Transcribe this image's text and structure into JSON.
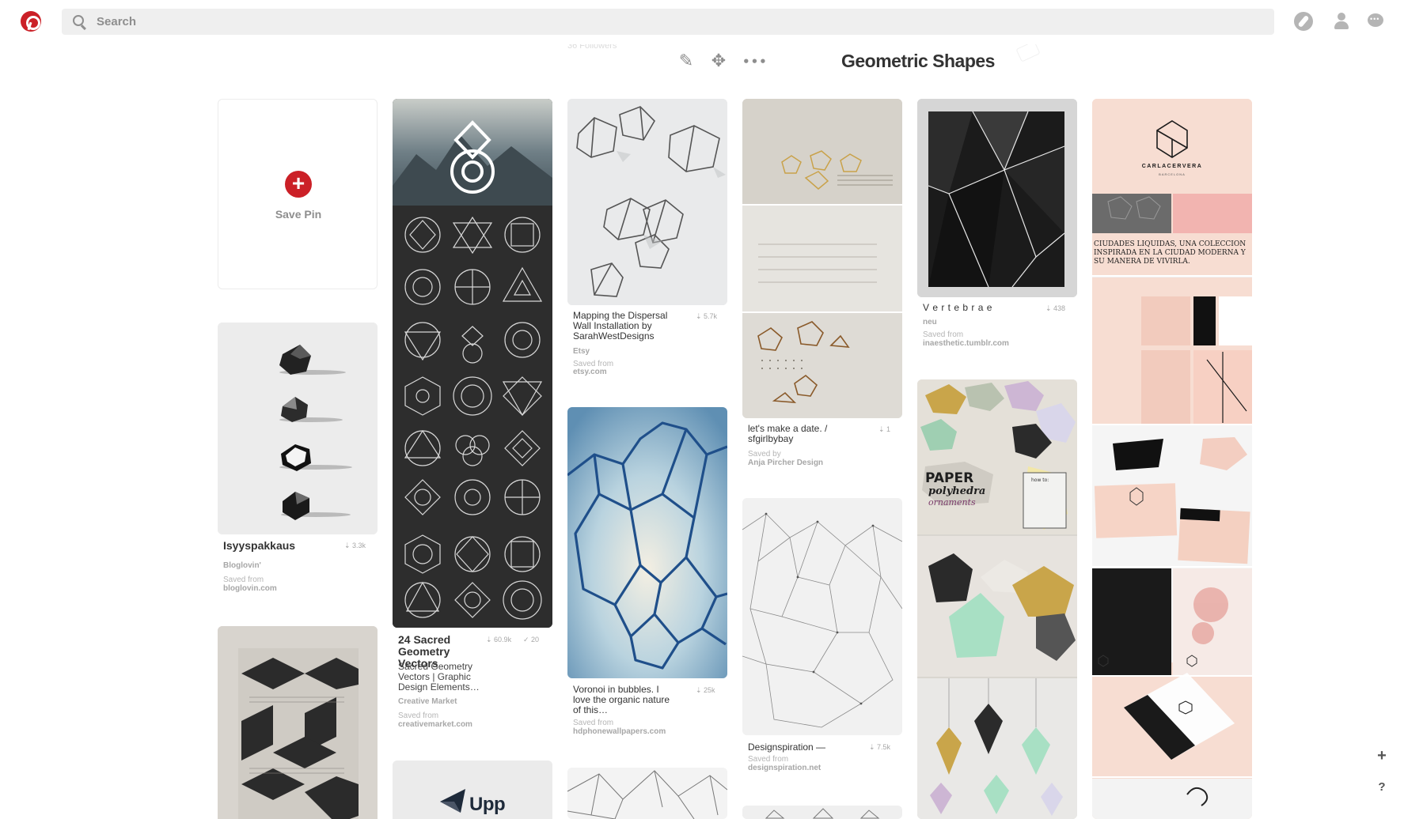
{
  "header": {
    "search_placeholder": "Search"
  },
  "board": {
    "title": "Geometric Shapes",
    "faded_count": "36 Followers"
  },
  "save_pin": {
    "label": "Save Pin"
  },
  "pins": {
    "isyyspakkaus": {
      "title": "Isyyspakkaus",
      "saves": "3.3k",
      "source": "Bloglovin'",
      "saved_label": "Saved from",
      "domain": "bloglovin.com"
    },
    "sacred": {
      "title": "24 Sacred Geometry Vectors",
      "saves": "60.9k",
      "tried": "20",
      "desc": "Sacred Geometry Vectors | Graphic Design Elements…",
      "source": "Creative Market",
      "saved_label": "Saved from",
      "domain": "creativemarket.com"
    },
    "mapping": {
      "title": "Mapping the Dispersal Wall Installation by SarahWestDesigns",
      "saves": "5.7k",
      "source": "Etsy",
      "saved_label": "Saved from",
      "domain": "etsy.com"
    },
    "voronoi": {
      "title": "Voronoi in bubbles. I love the organic nature of this…",
      "saves": "25k",
      "saved_label": "Saved from",
      "domain": "hdphonewallpapers.com"
    },
    "date": {
      "title": "let's make a date. / sfgirlbybay",
      "saves": "1",
      "saved_label": "Saved by",
      "domain": "Anja Pircher Design"
    },
    "designspiration": {
      "title": "Designspiration —",
      "saves": "7.5k",
      "saved_label": "Saved from",
      "domain": "designspiration.net"
    },
    "vertebrae": {
      "title": "V e r t e b r a e",
      "saves": "438",
      "source": "neu",
      "saved_label": "Saved from",
      "domain": "inaesthetic.tumblr.com"
    },
    "paper": {
      "line1": "PAPER",
      "line2": "polyhedra",
      "line3": "ornaments",
      "card": "how to:"
    },
    "carla": {
      "brand": "CARLACERVERA",
      "city": "BARCELONA",
      "tagline": "CIUDADES LIQUIDAS, UNA COLECCION INSPIRADA EN LA CIUDAD MODERNA Y SU MANERA DE VIVIRLA."
    },
    "upp": {
      "logo": "Upp"
    }
  },
  "colors": {
    "brand_red": "#cb2027",
    "search_bg": "#efefef",
    "icon_gray": "#b5b5b5"
  }
}
